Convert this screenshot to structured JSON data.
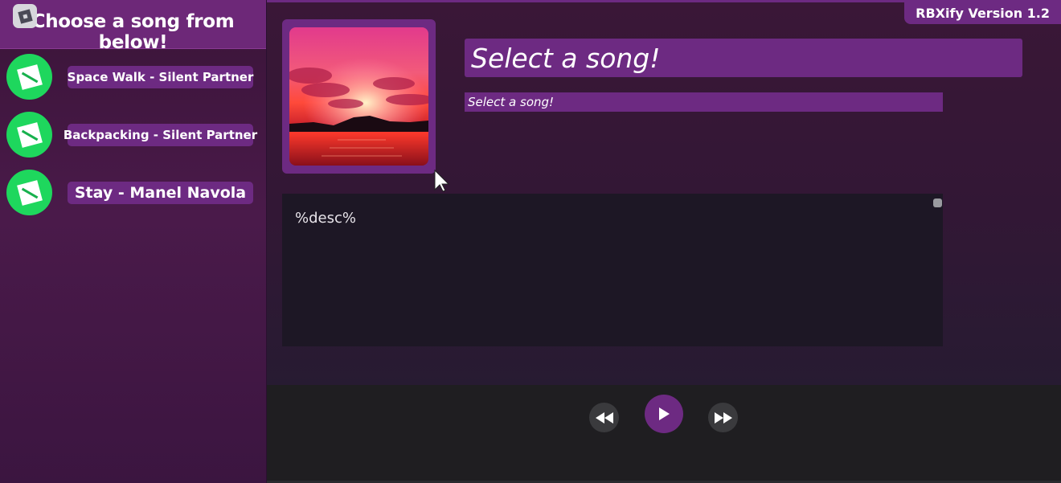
{
  "sidebar": {
    "title": "Choose a song from below!",
    "songs": [
      {
        "label": "Space Walk - Silent Partner"
      },
      {
        "label": "Backpacking - Silent Partner"
      },
      {
        "label": "Stay - Manel Navola"
      }
    ]
  },
  "header": {
    "version": "RBXify Version 1.2"
  },
  "player": {
    "title": "Select a song!",
    "subtitle": "Select a song!",
    "description": "%desc%"
  },
  "controls": {
    "rewind_icon": "rewind-icon",
    "play_icon": "play-icon",
    "forward_icon": "fast-forward-icon"
  },
  "colors": {
    "accent": "#6d2a82",
    "song_icon": "#1ed75d",
    "panel": "#1d1725"
  }
}
